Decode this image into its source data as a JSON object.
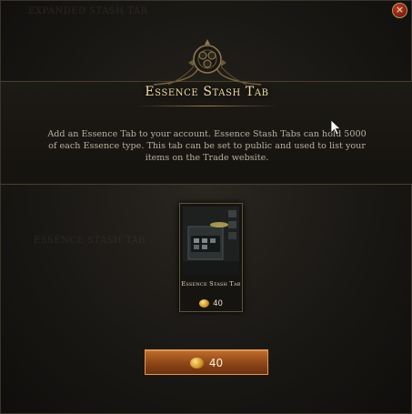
{
  "window": {
    "close_label": "×",
    "background_labels": [
      "EXPANDED STASH TAB",
      "ESSENCE STASH TAB"
    ]
  },
  "header": {
    "title": "Essence Stash Tab",
    "description": "Add an Essence Tab to your account. Essence Stash Tabs can hold 5000 of each Essence type. This tab can be set to public and used to list your items on the Trade website."
  },
  "item_card": {
    "name": "Essence Stash Tab",
    "price": "40",
    "icon": "stash-tab-preview-image"
  },
  "purchase": {
    "price": "40",
    "currency_icon": "coin-icon"
  },
  "colors": {
    "title": "#f0dcaa",
    "button": "#a2541e",
    "close": "#8a2414"
  }
}
